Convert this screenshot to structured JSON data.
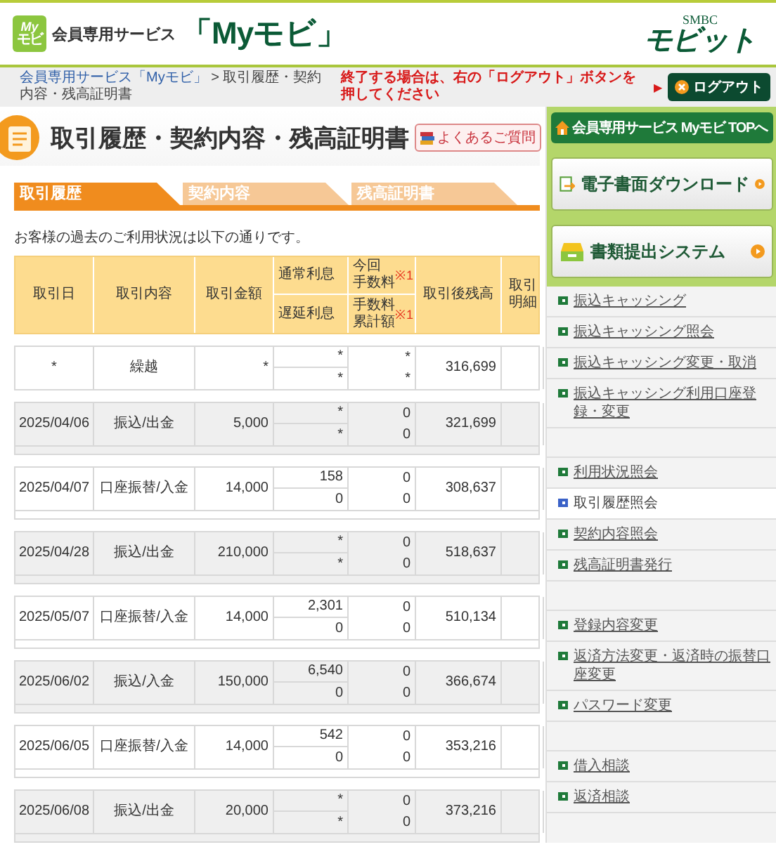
{
  "header": {
    "logo_badge": [
      "My",
      "モビ"
    ],
    "service_label": "会員専用サービス",
    "service_name": "「Myモビ」",
    "brand": {
      "top": "SMBC",
      "name": "モビット"
    }
  },
  "breadcrumb": {
    "link": "会員専用サービス「Myモビ」",
    "separator": ">",
    "current": "取引履歴・契約内容・残高証明書"
  },
  "logout": {
    "notice": "終了する場合は、右の「ログアウト」ボタンを押してください",
    "arrow": "▶",
    "button": "ログアウト"
  },
  "page_title": "取引履歴・契約内容・残高証明書",
  "faq_button": "よくあるご質問",
  "tabs": [
    {
      "label": "取引履歴",
      "selected": true
    },
    {
      "label": "契約内容",
      "selected": false
    },
    {
      "label": "残高証明書",
      "selected": false
    }
  ],
  "intro": "お客様の過去のご利用状況は以下の通りです。",
  "table": {
    "header": {
      "date": "取引日",
      "description": "取引内容",
      "amount": "取引金額",
      "interest_normal": "通常利息",
      "interest_late": "遅延利息",
      "fee_current": {
        "lines": [
          "今回",
          "手数料"
        ],
        "note": "※1"
      },
      "fee_total": {
        "lines": [
          "手数料",
          "累計額"
        ],
        "note": "※1"
      },
      "balance": "取引後残高",
      "detail": {
        "lines": [
          "取引",
          "明細"
        ]
      }
    },
    "rows": [
      {
        "kind": "carryover",
        "date": "*",
        "description": "繰越",
        "amount": "*",
        "interest_normal": "*",
        "interest_late": "*",
        "fee_current": "*",
        "fee_total": "*",
        "balance": "316,699"
      },
      {
        "kind": "transaction",
        "date": "2025/04/06",
        "description": "振込/出金",
        "amount": "5,000",
        "interest_normal": "*",
        "interest_late": "*",
        "fee_current": "0",
        "fee_total": "0",
        "balance": "321,699"
      },
      {
        "kind": "transaction",
        "date": "2025/04/07",
        "description": "口座振替/入金",
        "amount": "14,000",
        "interest_normal": "158",
        "interest_late": "0",
        "fee_current": "0",
        "fee_total": "0",
        "balance": "308,637"
      },
      {
        "kind": "transaction",
        "date": "2025/04/28",
        "description": "振込/出金",
        "amount": "210,000",
        "interest_normal": "*",
        "interest_late": "*",
        "fee_current": "0",
        "fee_total": "0",
        "balance": "518,637"
      },
      {
        "kind": "transaction",
        "date": "2025/05/07",
        "description": "口座振替/入金",
        "amount": "14,000",
        "interest_normal": "2,301",
        "interest_late": "0",
        "fee_current": "0",
        "fee_total": "0",
        "balance": "510,134"
      },
      {
        "kind": "transaction",
        "date": "2025/06/02",
        "description": "振込/入金",
        "amount": "150,000",
        "interest_normal": "6,540",
        "interest_late": "0",
        "fee_current": "0",
        "fee_total": "0",
        "balance": "366,674"
      },
      {
        "kind": "transaction",
        "date": "2025/06/05",
        "description": "口座振替/入金",
        "amount": "14,000",
        "interest_normal": "542",
        "interest_late": "0",
        "fee_current": "0",
        "fee_total": "0",
        "balance": "353,216"
      },
      {
        "kind": "transaction",
        "date": "2025/06/08",
        "description": "振込/出金",
        "amount": "20,000",
        "interest_normal": "*",
        "interest_late": "*",
        "fee_current": "0",
        "fee_total": "0",
        "balance": "373,216"
      }
    ]
  },
  "sidebar": {
    "top_button": "会員専用サービス Myモビ TOPへ",
    "feature_buttons": [
      {
        "kind": "download",
        "label": "電子書面ダウンロード"
      },
      {
        "kind": "submit",
        "label": "書類提出システム"
      }
    ],
    "link_groups": [
      [
        {
          "label": "振込キャッシング",
          "selected": false
        },
        {
          "label": "振込キャッシング照会",
          "selected": false
        },
        {
          "label": "振込キャッシング変更・取消",
          "selected": false
        },
        {
          "label": "振込キャッシング利用口座登録・変更",
          "selected": false
        }
      ],
      [
        {
          "label": "利用状況照会",
          "selected": false
        },
        {
          "label": "取引履歴照会",
          "selected": true
        },
        {
          "label": "契約内容照会",
          "selected": false
        },
        {
          "label": "残高証明書発行",
          "selected": false
        }
      ],
      [
        {
          "label": "登録内容変更",
          "selected": false
        },
        {
          "label": "返済方法変更・返済時の振替口座変更",
          "selected": false
        },
        {
          "label": "パスワード変更",
          "selected": false
        }
      ],
      [
        {
          "label": "借入相談",
          "selected": false
        },
        {
          "label": "返済相談",
          "selected": false
        }
      ]
    ]
  }
}
